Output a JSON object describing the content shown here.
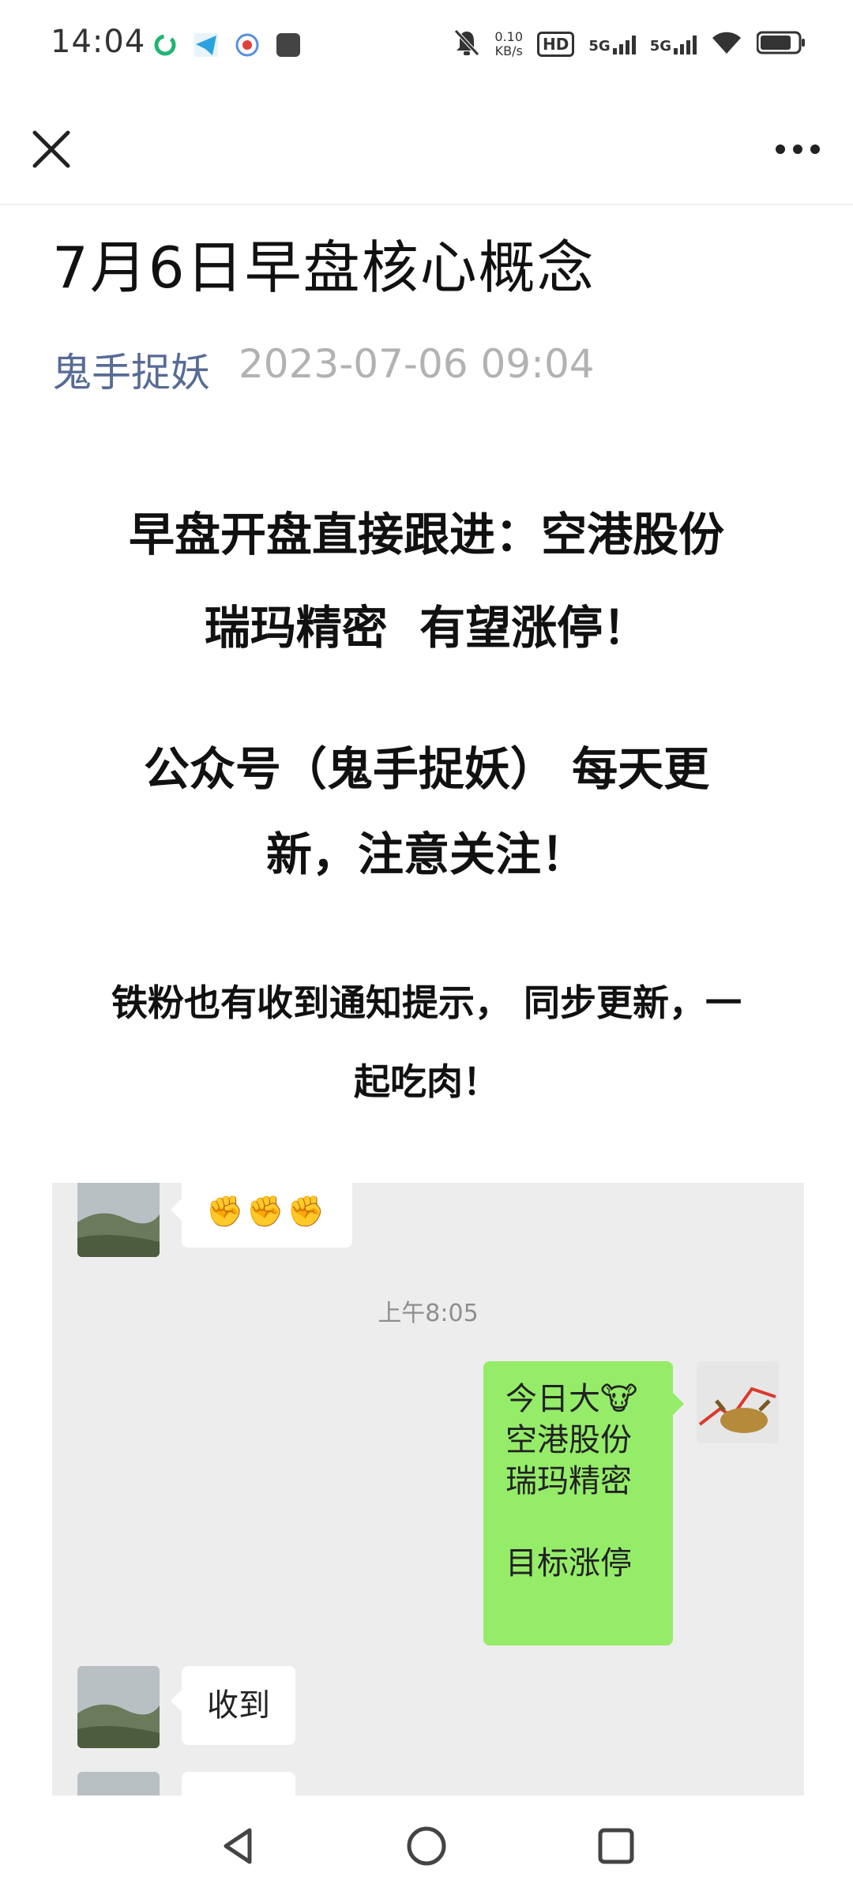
{
  "status_bar": {
    "time": "14:04",
    "net_speed_value": "0.10",
    "net_speed_unit": "KB/s",
    "hd_label": "HD",
    "signal1": "5G",
    "signal2": "5G"
  },
  "article": {
    "title": "7月6日早盘核心概念",
    "author": "鬼手捉妖",
    "date": "2023-07-06 09:04",
    "para1_line1": "早盘开盘直接跟进：空港股份",
    "para1_line2": "瑞玛精密  有望涨停！",
    "para2_line1": "公众号（鬼手捉妖） 每天更",
    "para2_line2": "新，注意关注！",
    "para3_line1": "铁粉也有收到通知提示， 同步更新，一",
    "para3_line2": "起吃肉！"
  },
  "chat": {
    "fist_emojis": "✊✊✊",
    "time_label": "上午8:05",
    "sent_message": "今日大🐮\n空港股份\n瑞玛精密\n\n目标涨停",
    "reply": "收到"
  },
  "colors": {
    "author": "#576b95",
    "date": "#b2b2b2",
    "chat_bg": "#ededed",
    "sent_bubble": "#95ec69"
  },
  "icons": {
    "close": "close-icon",
    "more": "more-icon",
    "back": "back-triangle-icon",
    "home": "home-circle-icon",
    "recents": "recents-square-icon"
  }
}
